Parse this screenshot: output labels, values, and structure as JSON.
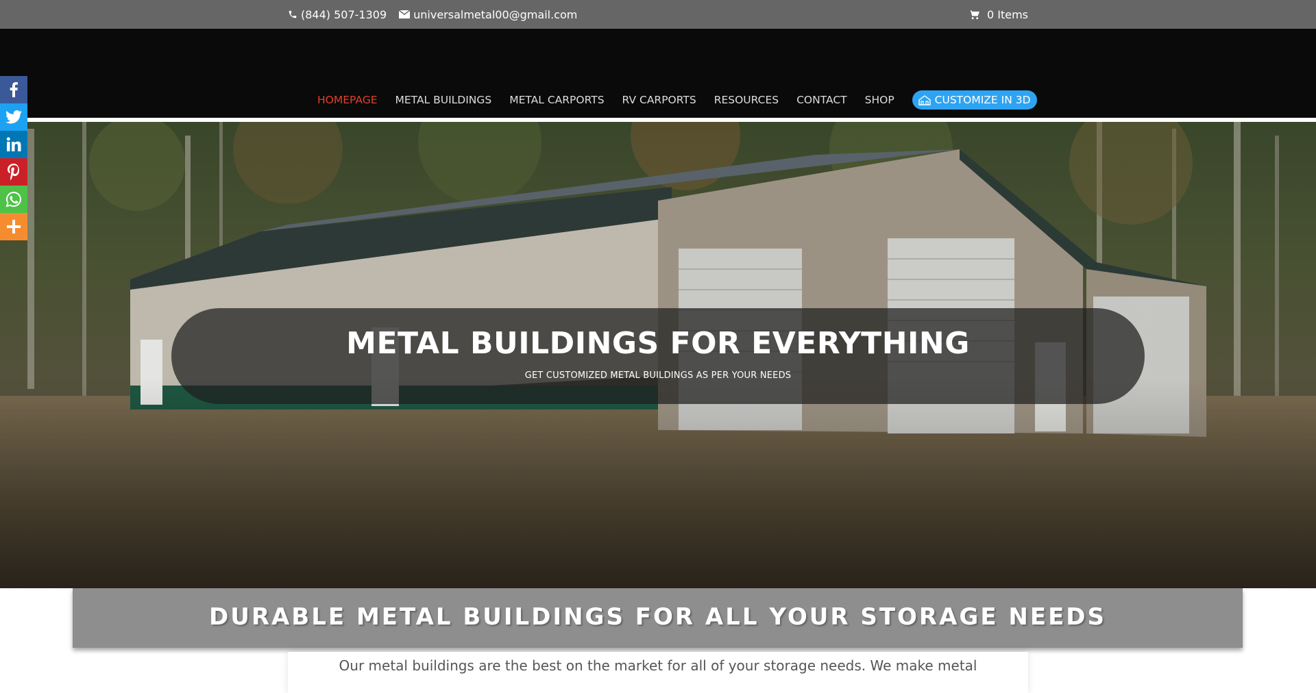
{
  "topbar": {
    "phone": "(844) 507-1309",
    "email": "universalmetal00@gmail.com",
    "cart": "0 Items"
  },
  "nav": {
    "items": [
      {
        "label": "HOMEPAGE",
        "active": true
      },
      {
        "label": "METAL BUILDINGS",
        "active": false
      },
      {
        "label": "METAL CARPORTS",
        "active": false
      },
      {
        "label": "RV CARPORTS",
        "active": false
      },
      {
        "label": "RESOURCES",
        "active": false
      },
      {
        "label": "CONTACT",
        "active": false
      },
      {
        "label": "SHOP",
        "active": false
      }
    ],
    "cta": "CUSTOMIZE IN 3D"
  },
  "hero": {
    "title": "METAL BUILDINGS FOR EVERYTHING",
    "subtitle": "GET CUSTOMIZED METAL BUILDINGS AS PER YOUR NEEDS"
  },
  "social": [
    {
      "icon": "facebook-icon",
      "color": "#3b5998"
    },
    {
      "icon": "twitter-icon",
      "color": "#1da1f2"
    },
    {
      "icon": "linkedin-icon",
      "color": "#0077b5"
    },
    {
      "icon": "pinterest-icon",
      "color": "#cb2027"
    },
    {
      "icon": "whatsapp-icon",
      "color": "#4dc247"
    },
    {
      "icon": "more-icon",
      "color": "#f58d30"
    }
  ],
  "section": {
    "title": "DURABLE METAL BUILDINGS FOR ALL YOUR STORAGE NEEDS",
    "text": "Our metal buildings are the best on the market for all of your storage needs. We make metal"
  },
  "colors": {
    "topbar": "#666666",
    "header": "#0a0a0a",
    "nav_active": "#e2402a",
    "cta": "#2ea3f2",
    "banner": "#8e8e8e"
  }
}
